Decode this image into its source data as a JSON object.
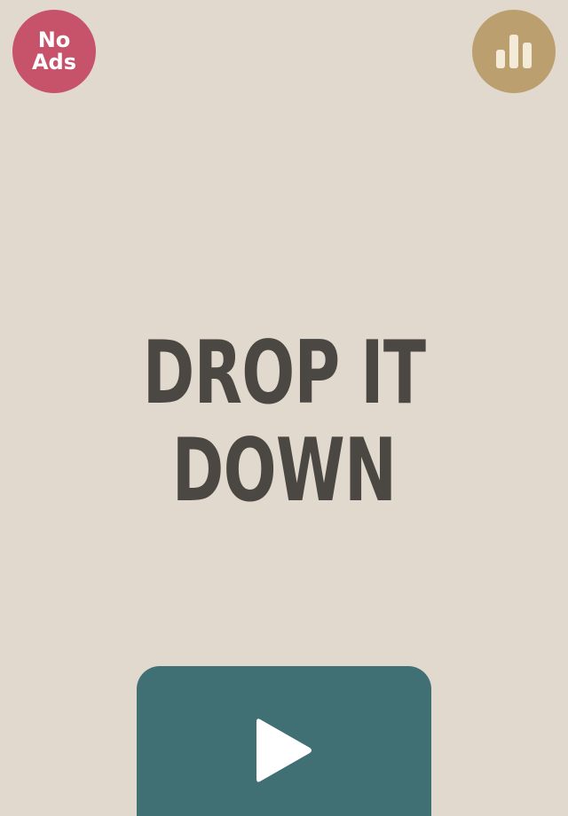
{
  "game": {
    "title_line_1": "DROP IT",
    "title_line_2": "DOWN"
  },
  "buttons": {
    "no_ads_line_1": "No",
    "no_ads_line_2": "Ads",
    "leaderboard_icon": "bar-chart-icon",
    "play_icon": "play-icon"
  },
  "colors": {
    "background": "#e2d9ce",
    "no_ads": "#c6536a",
    "leaderboard": "#bb9f6e",
    "leaderboard_icon": "#f3ead8",
    "title_text": "#4b4843",
    "play_button": "#407073",
    "play_icon": "#ffffff"
  }
}
